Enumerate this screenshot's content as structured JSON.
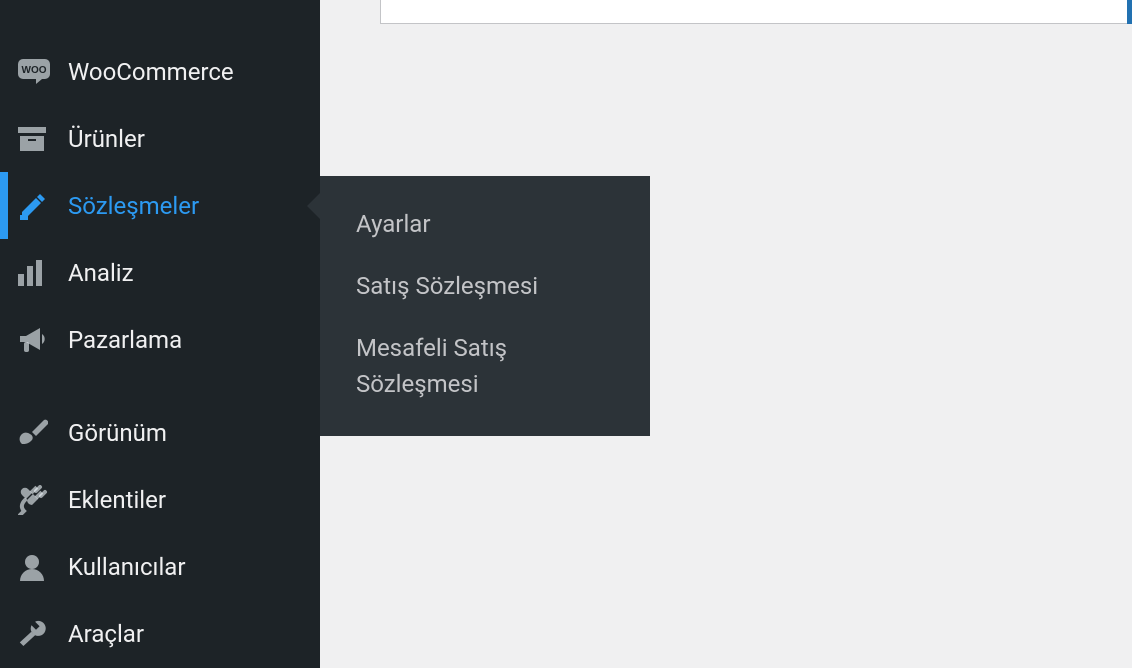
{
  "sidebar": {
    "items": [
      {
        "id": "woocommerce",
        "label": "WooCommerce"
      },
      {
        "id": "products",
        "label": "Ürünler"
      },
      {
        "id": "contracts",
        "label": "Sözleşmeler"
      },
      {
        "id": "analytics",
        "label": "Analiz"
      },
      {
        "id": "marketing",
        "label": "Pazarlama"
      },
      {
        "id": "appearance",
        "label": "Görünüm"
      },
      {
        "id": "plugins",
        "label": "Eklentiler"
      },
      {
        "id": "users",
        "label": "Kullanıcılar"
      },
      {
        "id": "tools",
        "label": "Araçlar"
      }
    ],
    "active": "contracts"
  },
  "flyout": {
    "items": [
      {
        "id": "settings",
        "label": "Ayarlar"
      },
      {
        "id": "sales-contract",
        "label": "Satış Sözleşmesi"
      },
      {
        "id": "distance-contract",
        "label": "Mesafeli Satış Sözleşmesi"
      }
    ]
  }
}
